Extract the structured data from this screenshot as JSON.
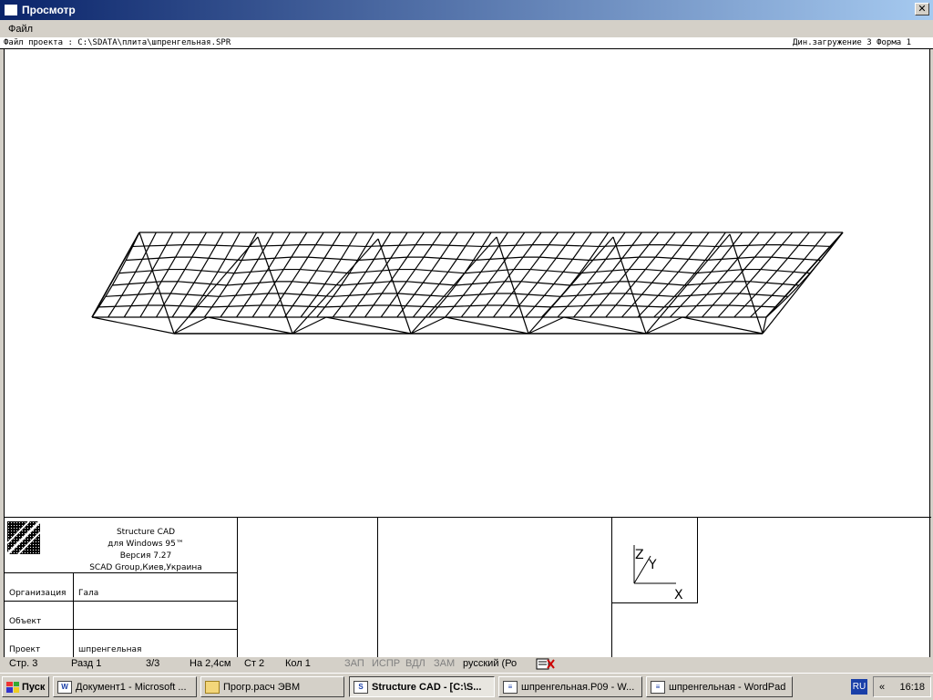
{
  "window": {
    "title": "Просмотр",
    "close_label": "✕"
  },
  "menu": {
    "file_label": "Файл"
  },
  "infobar": {
    "project_file": "Файл проекта : C:\\SDATA\\плита\\шпренгельная.SPR",
    "load_info": "Дин.загружение 3  Форма 1"
  },
  "stamp": {
    "program_lines": [
      "Structure CAD",
      "для Windows 95™",
      "Версия 7.27",
      "SCAD Group,Киев,Украина"
    ],
    "organization_label": "Организация",
    "organization_value": "Гала",
    "object_label": "Объект",
    "object_value": "",
    "project_label": "Проект",
    "project_value": "шпренгельная",
    "axes": {
      "z": "Z",
      "y": "Y",
      "x": "X"
    }
  },
  "statusbar": {
    "page": "Стр.  3",
    "section": "Разд  1",
    "pages_count": "3/3",
    "at": "На 2,4см",
    "line": "Ст  2",
    "column": "Кол  1",
    "rec": "ЗАП",
    "trk": "ИСПР",
    "ext": "ВДЛ",
    "ovr": "ЗАМ",
    "language": "русский (Ро"
  },
  "taskbar": {
    "start_label": "Пуск",
    "tasks": [
      {
        "label": "Документ1 - Microsoft ..."
      },
      {
        "label": "Прогр.расч ЭВМ"
      },
      {
        "label": "Structure CAD  - [C:\\S..."
      },
      {
        "label": "шпренгельная.P09 - W..."
      },
      {
        "label": "шпренгельная - WordPad"
      }
    ],
    "lang_indicator": "RU",
    "tray_arrow": "«",
    "clock": "16:18"
  },
  "colors": {
    "title_start": "#0a246a",
    "title_end": "#a6caf0",
    "face": "#d4d0c8"
  }
}
